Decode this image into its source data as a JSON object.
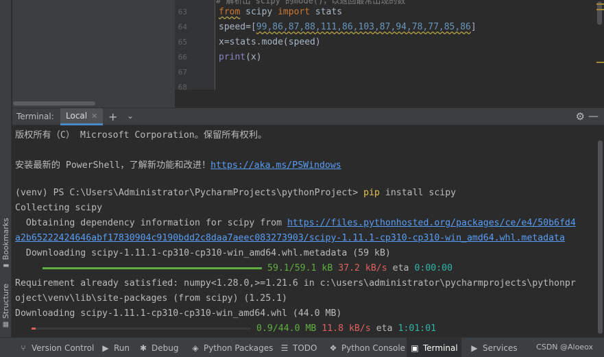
{
  "left_strip": {
    "bookmarks_label": "Bookmarks",
    "structure_label": "Structure"
  },
  "editor": {
    "top_comment": "# 解析出 scipy 的mode()，以返回最常出现的数",
    "line_numbers": [
      "63",
      "64",
      "65",
      "66",
      "67",
      "68"
    ],
    "lines": {
      "l63": {
        "kw1": "from",
        "mod": " scipy ",
        "kw2": "import",
        "rest": " stats"
      },
      "l64": {
        "prefix": "speed=[",
        "values": "99,86,87,88,111,86,103,87,94,78,77,85,86",
        "suffix": "]"
      },
      "l65": {
        "text": "x=stats.mode(speed)"
      },
      "l66": {
        "fn": "print",
        "rest": "(x)"
      }
    }
  },
  "terminal": {
    "title": "Terminal:",
    "tab_label": "Local",
    "lines": {
      "copyright": "版权所有（C） Microsoft Corporation。保留所有权利。",
      "ps_prefix": "安装最新的 PowerShell，了解新功能和改进！",
      "ps_link": "https://aka.ms/PSWindows",
      "prompt": "(venv) PS C:\\Users\\Administrator\\PycharmProjects\\pythonProject> ",
      "pip": "pip",
      "command": " install scipy",
      "collecting": "Collecting scipy",
      "obtaining_prefix": "  Obtaining dependency information for scipy from ",
      "obtaining_link_1": "https://files.pythonhosted.org/packages/ce/e4/50b6fd4",
      "obtaining_link_2": "a2b65222424646abf17830904c9190bdd2c8daa7aeec083273903/scipy-1.11.1-cp310-cp310-win_amd64.whl.metadata",
      "downloading_meta": "  Downloading scipy-1.11.1-cp310-cp310-win_amd64.whl.metadata (59 kB)",
      "meta_progress_size": "59.1/59.1 kB",
      "meta_progress_speed": "37.2 kB/s",
      "meta_eta_label": "eta",
      "meta_eta": "0:00:00",
      "requirement_1": "Requirement already satisfied: numpy<1.28.0,>=1.21.6 in c:\\users\\administrator\\pycharmprojects\\pythonpr",
      "requirement_2": "oject\\venv\\lib\\site-packages (from scipy) (1.25.1)",
      "downloading_whl": "Downloading scipy-1.11.1-cp310-cp310-win_amd64.whl (44.0 MB)",
      "whl_progress_size": "0.9/44.0 MB",
      "whl_progress_speed": "11.8 kB/s",
      "whl_eta_label": "eta",
      "whl_eta": "1:01:01"
    },
    "meta_progress_fraction": 1.0,
    "whl_progress_fraction": 0.02
  },
  "statusbar": {
    "items": [
      {
        "label": "Version Control",
        "icon": "branch-icon"
      },
      {
        "label": "Run",
        "icon": "play-icon"
      },
      {
        "label": "Debug",
        "icon": "bug-icon"
      },
      {
        "label": "Python Packages",
        "icon": "layers-icon"
      },
      {
        "label": "TODO",
        "icon": "list-icon"
      },
      {
        "label": "Python Console",
        "icon": "python-icon"
      },
      {
        "label": "Terminal",
        "icon": "terminal-icon"
      },
      {
        "label": "Services",
        "icon": "services-icon"
      }
    ],
    "credit": "CSDN @Aloeox"
  },
  "colors": {
    "accent": "#4a88c7",
    "progress_done": "#5faf3f",
    "progress_pending": "#e06060",
    "link": "#589df6",
    "prompt_pip": "#e8c34c"
  }
}
